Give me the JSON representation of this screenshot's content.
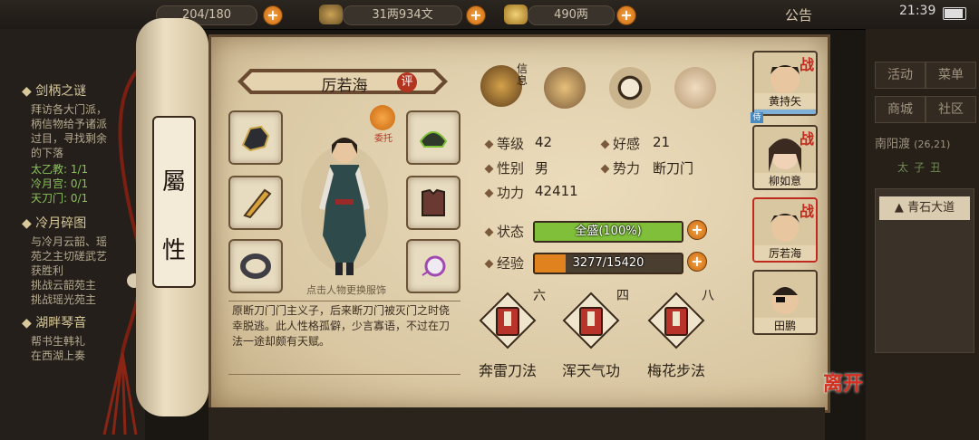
{
  "topbar": {
    "stamina": "204/180",
    "coins": "31两934文",
    "silver": "490两",
    "notice": "公告",
    "time": "21:39"
  },
  "quests": {
    "q1_title": "剑柄之谜",
    "q1_lines": [
      "拜访各大门派，",
      "柄信物给予诸派",
      "过目，寻找剩余",
      "的下落",
      "太乙教: 1/1",
      "冷月宫: 0/1",
      "天刀门: 0/1"
    ],
    "q2_title": "冷月碎图",
    "q2_lines": [
      "与冷月云韶、瑶",
      "苑之主切磋武艺",
      "获胜利",
      "挑战云韶苑主",
      "挑战瑶光苑主"
    ],
    "q3_title": "湖畔琴音",
    "q3_lines": [
      "帮书生韩礼",
      "在西湖上奏"
    ]
  },
  "scroll": {
    "title_chars": [
      "屬",
      "性"
    ]
  },
  "character": {
    "name": "厉若海",
    "rate_badge": "评",
    "entrust_label": "委托",
    "change_outfit_hint": "点击人物更换服饰",
    "description": "原断刀门门主义子，后来断刀门被灭门之时侥幸脱逃。此人性格孤僻，少言寡语，不过在刀法一途却颇有天赋。"
  },
  "top_icons": {
    "info_label": "信息"
  },
  "stats": {
    "level_label": "等级",
    "level": "42",
    "favor_label": "好感",
    "favor": "21",
    "gender_label": "性别",
    "gender": "男",
    "faction_label": "势力",
    "faction": "断刀门",
    "power_label": "功力",
    "power": "42411"
  },
  "bars": {
    "status_label": "状态",
    "status_text": "全盛(100%)",
    "status_fraction": 1.0,
    "exp_label": "经验",
    "exp_text": "3277/15420",
    "exp_fraction": 0.2125
  },
  "skills": [
    {
      "level": "六",
      "name": "奔雷刀法"
    },
    {
      "level": "四",
      "name": "浑天气功"
    },
    {
      "level": "八",
      "name": "梅花步法"
    }
  ],
  "party": [
    {
      "name": "黄持矢",
      "tag": "战",
      "badge": "侍"
    },
    {
      "name": "柳如意",
      "tag": "战"
    },
    {
      "name": "厉若海",
      "tag": "战"
    },
    {
      "name": "田鹏"
    }
  ],
  "right_menu": {
    "activity": "活动",
    "menu": "菜单",
    "shop": "商城",
    "community": "社区",
    "location": "南阳渡",
    "coords": "(26,21)",
    "region": "太子丑",
    "place": "青石大道"
  },
  "leave_label": "离开",
  "colors": {
    "status_bar": "#7fbf3a",
    "exp_bar": "#e0821e",
    "zhan_red": "#c02a1e"
  }
}
